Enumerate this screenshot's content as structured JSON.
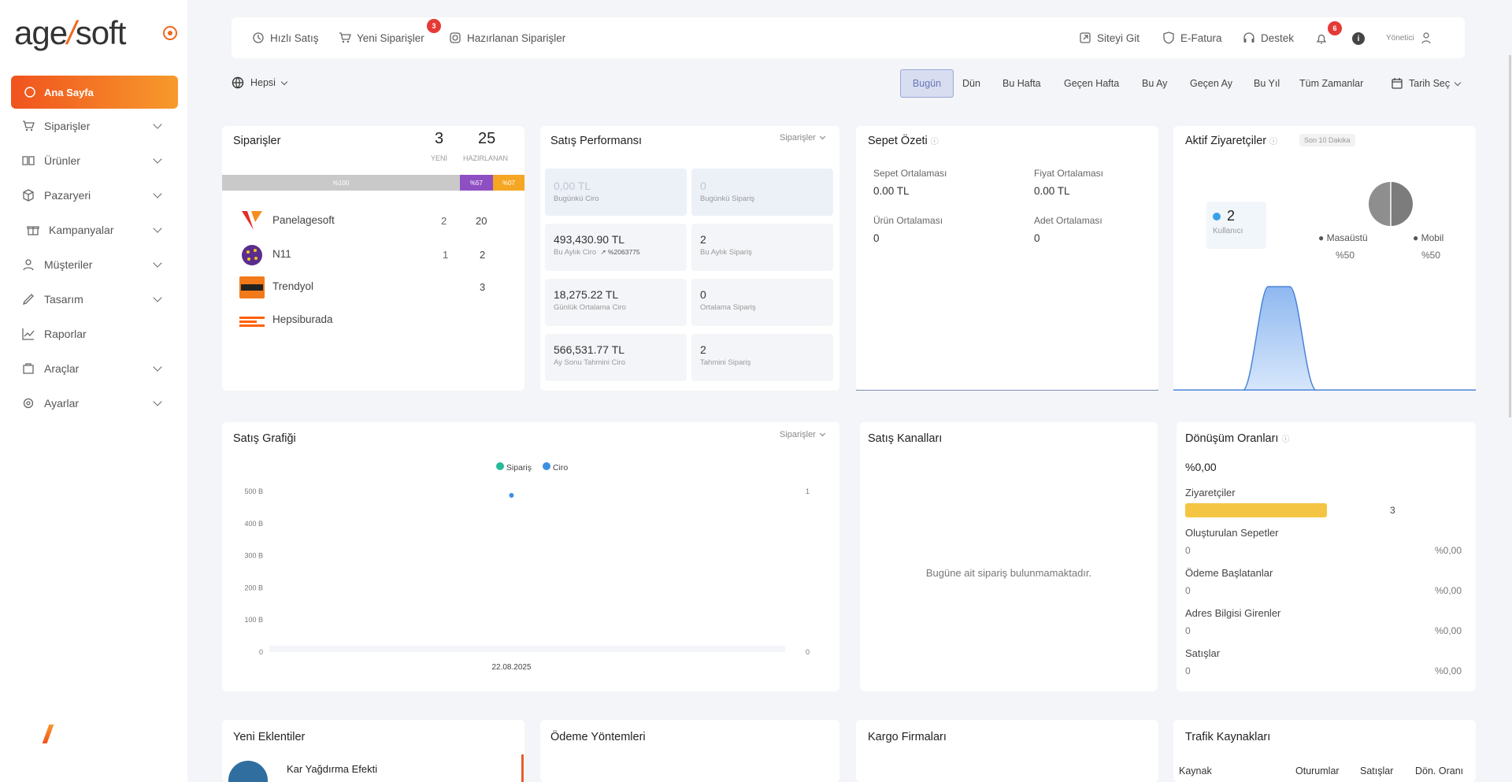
{
  "brand": {
    "logo_main": "age",
    "logo_slash": "/",
    "logo_end": "soft",
    "accent": "#f0671d"
  },
  "sidebar": {
    "active": "Ana Sayfa",
    "items": [
      {
        "label": "Siparişler",
        "icon": "cart-icon"
      },
      {
        "label": "Ürünler",
        "icon": "book-icon"
      },
      {
        "label": "Pazaryeri",
        "icon": "box-icon"
      },
      {
        "label": "Kampanyalar",
        "icon": "gift-icon"
      },
      {
        "label": "Müşteriler",
        "icon": "user-icon"
      },
      {
        "label": "Tasarım",
        "icon": "brush-icon"
      },
      {
        "label": "Raporlar",
        "icon": "chart-line-icon"
      },
      {
        "label": "Araçlar",
        "icon": "tools-icon"
      },
      {
        "label": "Ayarlar",
        "icon": "gear-icon"
      }
    ]
  },
  "topbar": {
    "quick_sale": "Hızlı Satış",
    "new_orders": "Yeni Siparişler",
    "new_orders_badge": "3",
    "prepared_orders": "Hazırlanan Siparişler",
    "visit_site": "Siteyi Git",
    "einvoice": "E-Fatura",
    "support": "Destek",
    "notifications_badge": "6",
    "user": "Yönetici"
  },
  "filters": {
    "scope": "Hepsi",
    "ranges": [
      "Bugün",
      "Dün",
      "Bu Hafta",
      "Geçen Hafta",
      "Bu Ay",
      "Geçen Ay",
      "Bu Yıl",
      "Tüm Zamanlar"
    ],
    "active_range": "Bugün",
    "date_pick": "Tarih Seç"
  },
  "orders": {
    "title": "Siparişler",
    "new_count": "3",
    "new_label": "YENİ",
    "prepared_count": "25",
    "prepared_label": "HAZIRLANAN",
    "bar_label_gray": "%100",
    "bar_label_purple": "%57",
    "bar_label_orange": "%07",
    "rows": [
      {
        "name": "Panelagesoft",
        "new": "2",
        "prepared": "20"
      },
      {
        "name": "N11",
        "new": "1",
        "prepared": "2"
      },
      {
        "name": "Trendyol",
        "new": "",
        "prepared": "3"
      },
      {
        "name": "Hepsiburada",
        "new": "",
        "prepared": ""
      }
    ]
  },
  "performance": {
    "title": "Satış Performansı",
    "dropdown": "Siparişler",
    "cells": [
      {
        "value": "0,00 TL",
        "label": "Bugünkü Ciro",
        "extra": ""
      },
      {
        "value": "0",
        "label": "Bugünkü Sipariş",
        "extra": ""
      },
      {
        "value": "493,430.90 TL",
        "label": "Bu Aylık Ciro",
        "extra": "%2063775"
      },
      {
        "value": "2",
        "label": "Bu Aylık Sipariş",
        "extra": ""
      },
      {
        "value": "18,275.22 TL",
        "label": "Günlük Ortalama Ciro",
        "extra": ""
      },
      {
        "value": "0",
        "label": "Ortalama Sipariş",
        "extra": ""
      },
      {
        "value": "566,531.77 TL",
        "label": "Ay Sonu Tahmini Ciro",
        "extra": ""
      },
      {
        "value": "2",
        "label": "Tahmini Sipariş",
        "extra": ""
      }
    ]
  },
  "cart_summary": {
    "title": "Sepet Özeti",
    "items": [
      {
        "label": "Sepet Ortalaması",
        "value": "0.00 TL"
      },
      {
        "label": "Fiyat Ortalaması",
        "value": "0.00 TL"
      },
      {
        "label": "Ürün Ortalaması",
        "value": "0"
      },
      {
        "label": "Adet Ortalaması",
        "value": "0"
      }
    ]
  },
  "visitors": {
    "title": "Aktif Ziyaretçiler",
    "period": "Son 10 Dakika",
    "count": "2",
    "count_label": "Kullanıcı",
    "desktop_label": "Masaüstü",
    "desktop_pct": "%50",
    "mobile_label": "Mobil",
    "mobile_pct": "%50",
    "desktop_color": "#8a8a8a",
    "mobile_color": "#6e6e6e",
    "area_color": "#9ec3f5"
  },
  "sales_chart": {
    "title": "Satış Grafiği",
    "dropdown": "Siparişler",
    "legend": [
      {
        "name": "Sipariş",
        "color": "#26b99a"
      },
      {
        "name": "Ciro",
        "color": "#3d8fe0"
      }
    ]
  },
  "chart_data": {
    "type": "scatter",
    "title": "",
    "x": [
      "22.08.2025"
    ],
    "series": [
      {
        "name": "Sipariş",
        "values": [
          0
        ]
      },
      {
        "name": "Ciro",
        "values": [
          500
        ]
      }
    ],
    "y_left_ticks": [
      "0",
      "100 B",
      "200 B",
      "300 B",
      "400 B",
      "500 B"
    ],
    "y_right_ticks": [
      "0",
      "1"
    ],
    "ylim": [
      0,
      500
    ],
    "legend_position": "top-center"
  },
  "sales_channels": {
    "title": "Satış Kanalları",
    "empty": "Bugüne ait sipariş bulunmamaktadır."
  },
  "conversion": {
    "title": "Dönüşüm Oranları",
    "rate": "%0,00",
    "visitors_label": "Ziyaretçiler",
    "visitors_count": "3",
    "visitors_fill": 0.72,
    "steps": [
      {
        "label": "Oluşturulan Sepetler",
        "count": "0",
        "pct": "%0,00"
      },
      {
        "label": "Ödeme Başlatanlar",
        "count": "0",
        "pct": "%0,00"
      },
      {
        "label": "Adres Bilgisi Girenler",
        "count": "0",
        "pct": "%0,00"
      },
      {
        "label": "Satışlar",
        "count": "0",
        "pct": "%0,00"
      }
    ]
  },
  "new_plugins": {
    "title": "Yeni Eklentiler",
    "first": "Kar Yağdırma Efekti"
  },
  "payment_methods": {
    "title": "Ödeme Yöntemleri"
  },
  "cargo": {
    "title": "Kargo Firmaları"
  },
  "traffic": {
    "title": "Trafik Kaynakları",
    "columns": [
      "Kaynak",
      "Oturumlar",
      "Satışlar",
      "Dön. Oranı"
    ]
  }
}
